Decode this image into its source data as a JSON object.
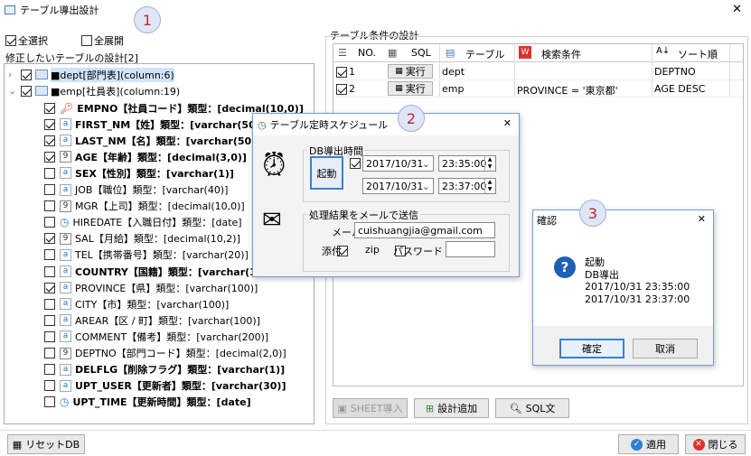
{
  "window": {
    "title": "テーブル導出設計",
    "close": "✕"
  },
  "markers": [
    "1",
    "2",
    "3"
  ],
  "top": {
    "select_all": "全選択",
    "expand_all": "全展開"
  },
  "left": {
    "title": "修正したいテーブルの設計[2]"
  },
  "tree": {
    "dept": "■dept[部門表](column:6)",
    "emp": "■emp[社員表](column:19)",
    "cols": [
      {
        "t": "key",
        "checked": true,
        "bold": true,
        "label": "EMPNO【社員コード】類型：[decimal(10,0)]"
      },
      {
        "t": "a",
        "checked": true,
        "bold": true,
        "label": "FIRST_NM【姓】類型：[varchar(50)]"
      },
      {
        "t": "a",
        "checked": true,
        "bold": true,
        "label": "LAST_NM【名】類型：[varchar(50)]"
      },
      {
        "t": "9",
        "checked": true,
        "bold": true,
        "label": "AGE【年齢】類型：[decimal(3,0)]"
      },
      {
        "t": "a",
        "checked": false,
        "bold": true,
        "label": "SEX【性別】類型：[varchar(1)]"
      },
      {
        "t": "a",
        "checked": false,
        "bold": false,
        "label": "JOB【職位】類型：[varchar(40)]"
      },
      {
        "t": "9",
        "checked": false,
        "bold": false,
        "label": "MGR【上司】類型：[decimal(10,0)]"
      },
      {
        "t": "clock",
        "checked": false,
        "bold": false,
        "label": "HIREDATE【入職日付】類型：[date]"
      },
      {
        "t": "9",
        "checked": true,
        "bold": false,
        "label": "SAL【月給】類型：[decimal(10,2)]"
      },
      {
        "t": "a",
        "checked": false,
        "bold": false,
        "label": "TEL【携帯番号】類型：[varchar(20)]"
      },
      {
        "t": "a",
        "checked": false,
        "bold": true,
        "label": "COUNTRY【国籍】類型：[varchar(100)]"
      },
      {
        "t": "a",
        "checked": true,
        "bold": false,
        "label": "PROVINCE【県】類型：[varchar(100)]"
      },
      {
        "t": "a",
        "checked": false,
        "bold": false,
        "label": "CITY【市】類型：[varchar(100)]"
      },
      {
        "t": "a",
        "checked": false,
        "bold": false,
        "label": "AREAR【区 / 町】類型：[varchar(100)]"
      },
      {
        "t": "a",
        "checked": false,
        "bold": false,
        "label": "COMMENT【備考】類型：[varchar(200)]"
      },
      {
        "t": "9",
        "checked": false,
        "bold": false,
        "label": "DEPTNO【部門コード】類型：[decimal(2,0)]"
      },
      {
        "t": "a",
        "checked": false,
        "bold": true,
        "label": "DELFLG【削除フラグ】類型：[varchar(1)]"
      },
      {
        "t": "a",
        "checked": false,
        "bold": true,
        "label": "UPT_USER【更新者】類型：[varchar(30)]"
      },
      {
        "t": "clock",
        "checked": false,
        "bold": true,
        "label": "UPT_TIME【更新時間】類型：[date]"
      }
    ]
  },
  "right": {
    "title": "テーブル条件の設計",
    "headers": {
      "no": "NO.",
      "sql": "SQL",
      "table": "テーブル",
      "cond": "検索条件",
      "sort": "ソート順"
    },
    "rows": [
      {
        "no": "1",
        "exec": "実行",
        "table": "dept",
        "cond": "",
        "sort": "DEPTNO"
      },
      {
        "no": "2",
        "exec": "実行",
        "table": "emp",
        "cond": "PROVINCE = '東京都'",
        "sort": "AGE DESC"
      }
    ],
    "buttons": {
      "sheet": "SHEET導入",
      "add": "設計追加",
      "sql": "SQL文"
    }
  },
  "bottom": {
    "reset": "リセットDB",
    "apply": "適用",
    "close": "閉じる"
  },
  "schedule": {
    "title": "テーブル定時スケジュール",
    "group1": "DB導出時間",
    "start": "起動",
    "date1": "2017/10/31",
    "time1": "23:35:00",
    "date2": "2017/10/31",
    "time2": "23:37:00",
    "group2": "処理結果をメールで送信",
    "mail_label": "メール",
    "mail": "cuishuangjia@gmail.com",
    "attach": "添付",
    "zip": "zip",
    "password_label": "パスワード",
    "password": ""
  },
  "confirm": {
    "title": "確認",
    "lines": [
      "起動",
      "DB導出",
      "2017/10/31 23:35:00",
      "2017/10/31 23:37:00"
    ],
    "ok": "確定",
    "cancel": "取消"
  }
}
